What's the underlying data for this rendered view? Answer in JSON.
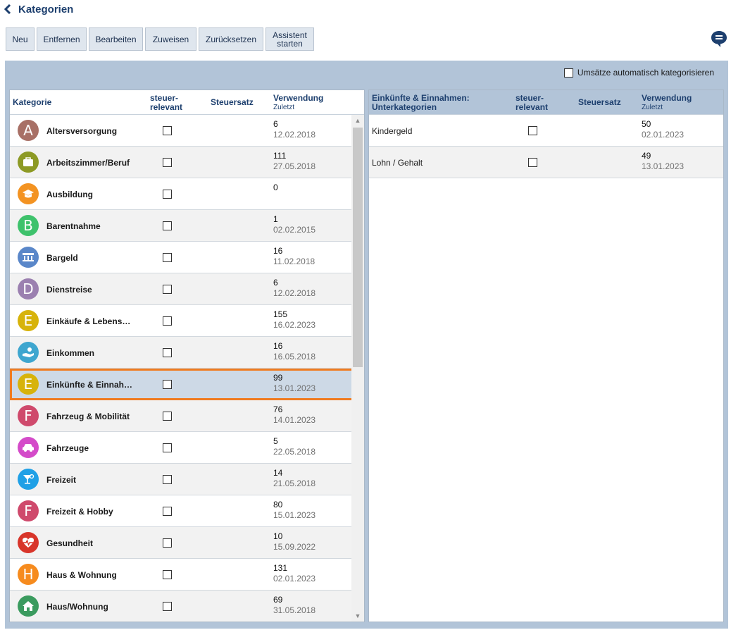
{
  "header": {
    "title": "Kategorien"
  },
  "toolbar": {
    "buttons": [
      {
        "label": "Neu"
      },
      {
        "label": "Entfernen"
      },
      {
        "label": "Bearbeiten"
      },
      {
        "label": "Zuweisen"
      },
      {
        "label": "Zurücksetzen"
      },
      {
        "line1": "Assistent",
        "line2": "starten"
      }
    ]
  },
  "auto_categorize": {
    "label": "Umsätze automatisch kategorisieren",
    "checked": false
  },
  "left_table": {
    "headers": {
      "category": "Kategorie",
      "tax_relevant_1": "steuer-",
      "tax_relevant_2": "relevant",
      "tax_rate": "Steuersatz",
      "usage": "Verwendung",
      "usage_sub": "Zuletzt"
    },
    "rows": [
      {
        "icon": "A",
        "color": "#a87066",
        "name": "Altersversorgung",
        "count": "6",
        "date": "12.02.2018"
      },
      {
        "icon": "briefcase-icon",
        "color": "#8d9a25",
        "name": "Arbeitszimmer/Beruf",
        "count": "111",
        "date": "27.05.2018"
      },
      {
        "icon": "graduation-cap-icon",
        "color": "#f39322",
        "name": "Ausbildung",
        "count": "0",
        "date": ""
      },
      {
        "icon": "B",
        "color": "#3ec26c",
        "name": "Barentnahme",
        "count": "1",
        "date": "02.02.2015"
      },
      {
        "icon": "bank-icon",
        "color": "#5a87c9",
        "name": "Bargeld",
        "count": "16",
        "date": "11.02.2018"
      },
      {
        "icon": "D",
        "color": "#9b80b0",
        "name": "Dienstreise",
        "count": "6",
        "date": "12.02.2018"
      },
      {
        "icon": "E",
        "color": "#d7b30b",
        "name": "Einkäufe & Lebens…",
        "count": "155",
        "date": "16.02.2023"
      },
      {
        "icon": "income-hand-icon",
        "color": "#3ea6cf",
        "name": "Einkommen",
        "count": "16",
        "date": "16.05.2018"
      },
      {
        "icon": "E",
        "color": "#d7b30b",
        "name": "Einkünfte & Einnah…",
        "count": "99",
        "date": "13.01.2023",
        "selected": true
      },
      {
        "icon": "F",
        "color": "#cf4a6c",
        "name": "Fahrzeug & Mobilität",
        "count": "76",
        "date": "14.01.2023"
      },
      {
        "icon": "car-icon",
        "color": "#d44bc9",
        "name": "Fahrzeuge",
        "count": "5",
        "date": "22.05.2018"
      },
      {
        "icon": "cocktail-icon",
        "color": "#1fa0e6",
        "name": "Freizeit",
        "count": "14",
        "date": "21.05.2018"
      },
      {
        "icon": "F",
        "color": "#cf4a6c",
        "name": "Freizeit & Hobby",
        "count": "80",
        "date": "15.01.2023"
      },
      {
        "icon": "heart-pulse-icon",
        "color": "#d8352a",
        "name": "Gesundheit",
        "count": "10",
        "date": "15.09.2022"
      },
      {
        "icon": "H",
        "color": "#f68b1e",
        "name": "Haus & Wohnung",
        "count": "131",
        "date": "02.01.2023"
      },
      {
        "icon": "house-icon",
        "color": "#3b9b5f",
        "name": "Haus/Wohnung",
        "count": "69",
        "date": "31.05.2018"
      }
    ]
  },
  "right_table": {
    "headers": {
      "subcategory_1": "Einkünfte & Einnahmen:",
      "subcategory_2": "Unterkategorien",
      "tax_relevant_1": "steuer-",
      "tax_relevant_2": "relevant",
      "tax_rate": "Steuersatz",
      "usage": "Verwendung",
      "usage_sub": "Zuletzt"
    },
    "rows": [
      {
        "name": "Kindergeld",
        "count": "50",
        "date": "02.01.2023"
      },
      {
        "name": "Lohn / Gehalt",
        "count": "49",
        "date": "13.01.2023"
      }
    ]
  }
}
